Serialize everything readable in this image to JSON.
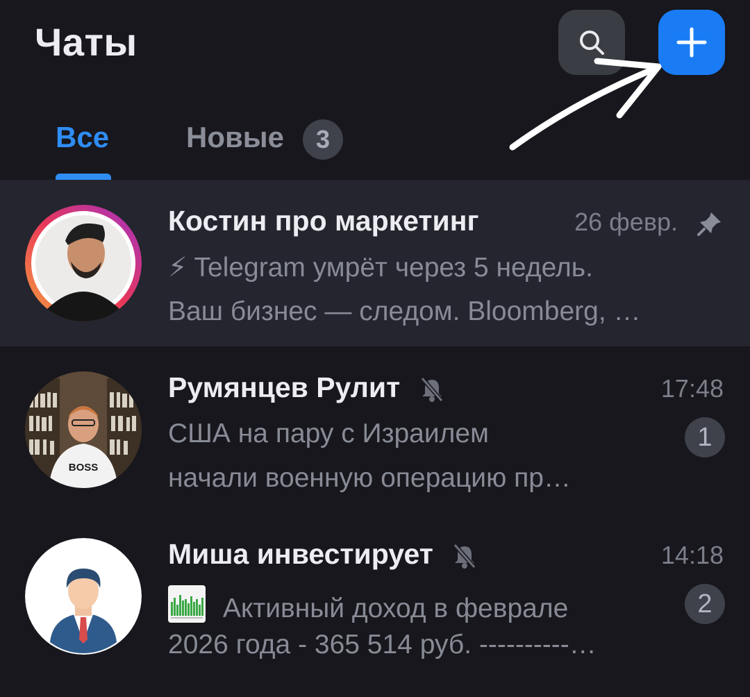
{
  "header": {
    "title": "Чаты"
  },
  "tabs": [
    {
      "label": "Все",
      "active": true
    },
    {
      "label": "Новые",
      "badge": "3"
    }
  ],
  "colors": {
    "accent": "#2f8df5",
    "new_button": "#1a7cf5",
    "background": "#17171d",
    "pinned_row": "#24252e"
  },
  "icons": {
    "search": "search-icon",
    "new": "plus-icon",
    "pin": "pin-icon",
    "muted": "muted-bell-icon"
  },
  "chats": [
    {
      "name": "Костин про маркетинг",
      "date": "26 февр.",
      "pinned": true,
      "line1": "⚡ Telegram умрёт через 5 недель.",
      "line2": "Ваш бизнес — следом. Bloomberg, …"
    },
    {
      "name": "Румянцев Рулит",
      "date": "17:48",
      "muted": true,
      "unread": "1",
      "line1": "США на пару с Израилем",
      "line2": "начали военную операцию пр…",
      "avatar_text": "BOSS"
    },
    {
      "name": "Миша инвестирует",
      "date": "14:18",
      "muted": true,
      "unread": "2",
      "line1": "Активный доход в феврале",
      "line2": "2026 года - 365 514 руб. ----------…"
    }
  ]
}
